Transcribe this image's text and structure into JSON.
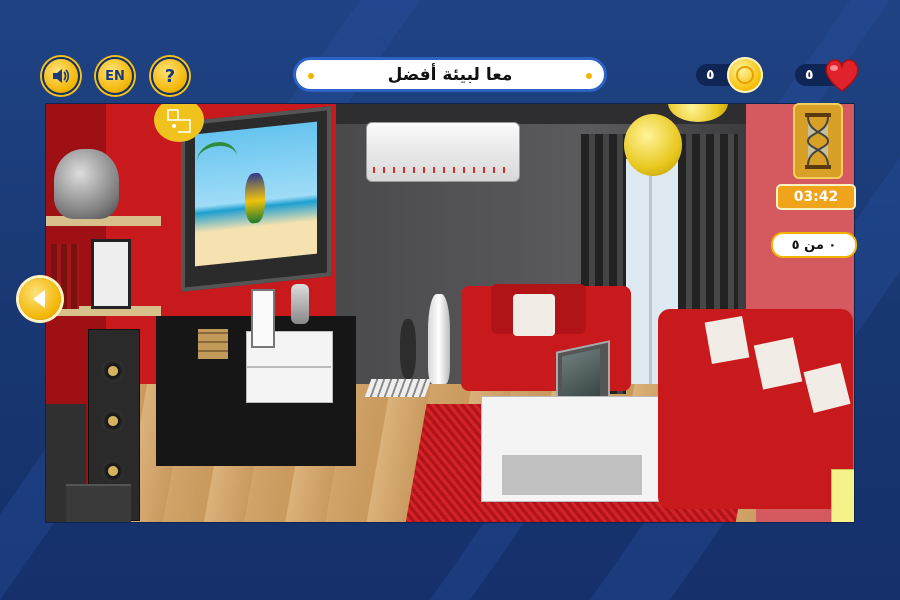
{
  "header": {
    "title": "معا لبيئة أفضل",
    "lang_label": "EN",
    "help_label": "?"
  },
  "stats": {
    "coins": "٥",
    "lives": "٥"
  },
  "side_panel": {
    "timer": "03:42",
    "progress": "٠ من ٥"
  },
  "icons": {
    "sound": "speaker-icon",
    "coin": "coin-icon",
    "heart": "heart-icon",
    "hourglass": "hourglass-icon",
    "back": "arrow-left-icon",
    "map": "floorplan-icon"
  },
  "colors": {
    "background": "#1b3b78",
    "accent": "#f3b400",
    "title_border": "#2d63c4",
    "heart": "#e0232b",
    "wall_red": "#c8191c"
  }
}
